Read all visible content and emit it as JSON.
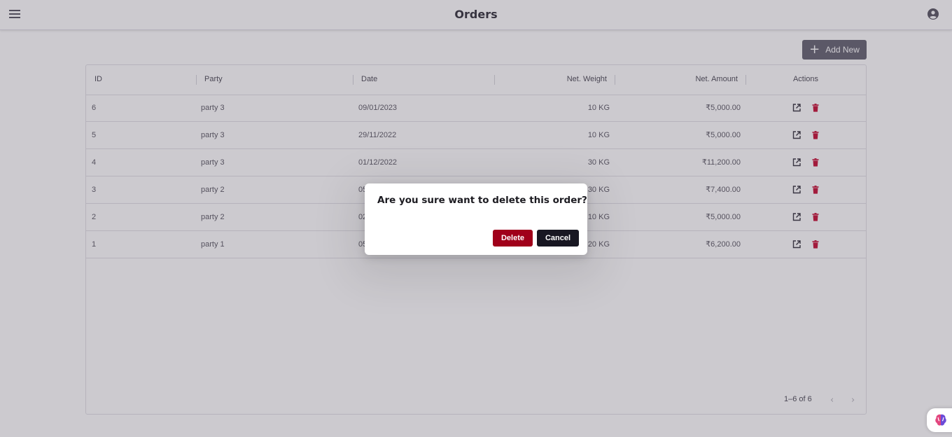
{
  "app": {
    "title": "Orders"
  },
  "toolbar": {
    "add_label": "Add New"
  },
  "table": {
    "columns": [
      "ID",
      "Party",
      "Date",
      "Net. Weight",
      "Net. Amount",
      "Actions"
    ],
    "rows": [
      {
        "id": "6",
        "party": "party 3",
        "date": "09/01/2023",
        "weight": "10 KG",
        "amount": "₹5,000.00"
      },
      {
        "id": "5",
        "party": "party 3",
        "date": "29/11/2022",
        "weight": "10 KG",
        "amount": "₹5,000.00"
      },
      {
        "id": "4",
        "party": "party 3",
        "date": "01/12/2022",
        "weight": "30 KG",
        "amount": "₹11,200.00"
      },
      {
        "id": "3",
        "party": "party 2",
        "date": "05",
        "weight": "30 KG",
        "amount": "₹7,400.00"
      },
      {
        "id": "2",
        "party": "party 2",
        "date": "02",
        "weight": "10 KG",
        "amount": "₹5,000.00"
      },
      {
        "id": "1",
        "party": "party 1",
        "date": "05",
        "weight": "20 KG",
        "amount": "₹6,200.00"
      }
    ],
    "pagination": {
      "range": "1–6 of 6"
    }
  },
  "dialog": {
    "title": "Are you sure want to delete this order?",
    "delete_label": "Delete",
    "cancel_label": "Cancel"
  },
  "colors": {
    "danger": "#a0001a",
    "dark": "#181722",
    "add_button": "#6b6a77"
  },
  "icons": [
    "menu-icon",
    "account-circle-icon",
    "plus-icon",
    "open-in-new-icon",
    "trash-icon",
    "chevron-left-icon",
    "chevron-right-icon",
    "brain-icon"
  ]
}
